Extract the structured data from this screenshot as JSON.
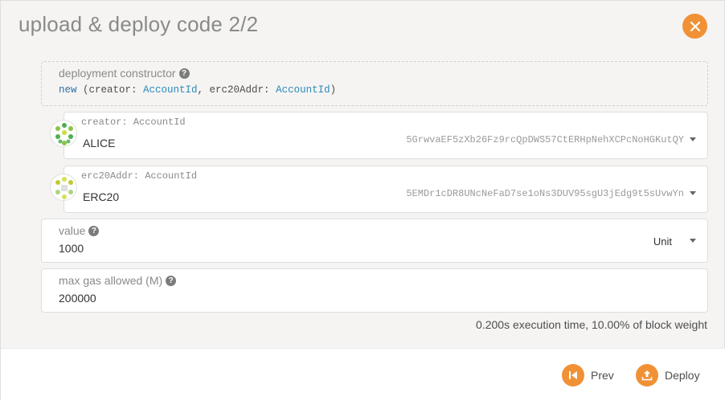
{
  "modal": {
    "title": "upload & deploy code 2/2"
  },
  "constructor": {
    "label": "deployment constructor",
    "keyword": "new",
    "signature_open": " (creator: ",
    "type1": "AccountId",
    "sep": ", erc20Addr: ",
    "type2": "AccountId",
    "signature_close": ")"
  },
  "creator": {
    "label": "creator: AccountId",
    "name": "ALICE",
    "address": "5GrwvaEF5zXb26Fz9rcQpDWS57CtERHpNehXCPcNoHGKutQY"
  },
  "erc20": {
    "label": "erc20Addr: AccountId",
    "name": "ERC20",
    "address": "5EMDr1cDR8UNcNeFaD7se1oNs3DUV95sgU3jEdg9t5sUvwYn"
  },
  "value": {
    "label": "value",
    "amount": "1000",
    "unit": "Unit"
  },
  "gas": {
    "label": "max gas allowed (M)",
    "amount": "200000"
  },
  "footnote": "0.200s execution time, 10.00% of block weight",
  "footer": {
    "prev_label": "Prev",
    "deploy_label": "Deploy"
  },
  "colors": {
    "accent": "#f19135"
  }
}
